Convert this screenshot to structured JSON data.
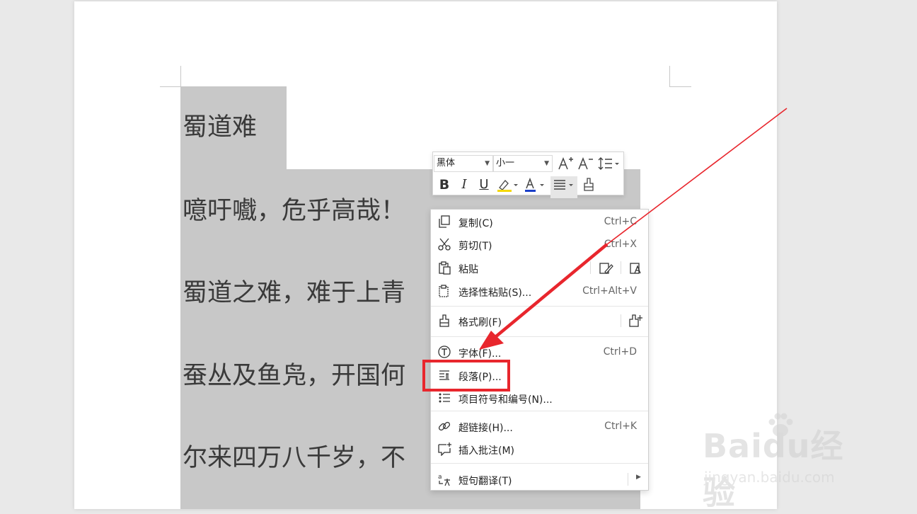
{
  "document": {
    "lines": [
      "蜀道难",
      "噫吁嚱，危乎高哉！",
      "蜀道之难，难于上青",
      "蚕丛及鱼凫，开国何",
      "尔来四万八千岁，不"
    ]
  },
  "mini_toolbar": {
    "font_name": "黑体",
    "font_size": "小一",
    "colors": {
      "highlight": "#f5d800",
      "font_color": "#1a3fc8"
    }
  },
  "context_menu": {
    "items": [
      {
        "label": "复制(C)",
        "shortcut": "Ctrl+C",
        "icon": "copy-icon"
      },
      {
        "label": "剪切(T)",
        "shortcut": "Ctrl+X",
        "icon": "cut-icon"
      },
      {
        "label": "粘贴",
        "shortcut": "",
        "icon": "paste-icon"
      },
      {
        "label": "选择性粘贴(S)...",
        "shortcut": "Ctrl+Alt+V",
        "icon": "paste-special-icon"
      },
      {
        "label": "格式刷(F)",
        "shortcut": "",
        "icon": "format-painter-icon"
      },
      {
        "label": "字体(F)...",
        "shortcut": "Ctrl+D",
        "icon": "font-icon"
      },
      {
        "label": "段落(P)...",
        "shortcut": "",
        "icon": "paragraph-icon"
      },
      {
        "label": "项目符号和编号(N)...",
        "shortcut": "",
        "icon": "bullets-icon"
      },
      {
        "label": "超链接(H)...",
        "shortcut": "Ctrl+K",
        "icon": "link-icon"
      },
      {
        "label": "插入批注(M)",
        "shortcut": "",
        "icon": "comment-icon"
      },
      {
        "label": "短句翻译(T)",
        "shortcut": "",
        "icon": "translate-icon"
      }
    ]
  },
  "annotation": {
    "color": "#e8262d"
  },
  "watermark": {
    "brand": "Baidu经验",
    "url": "jingyan.baidu.com"
  }
}
